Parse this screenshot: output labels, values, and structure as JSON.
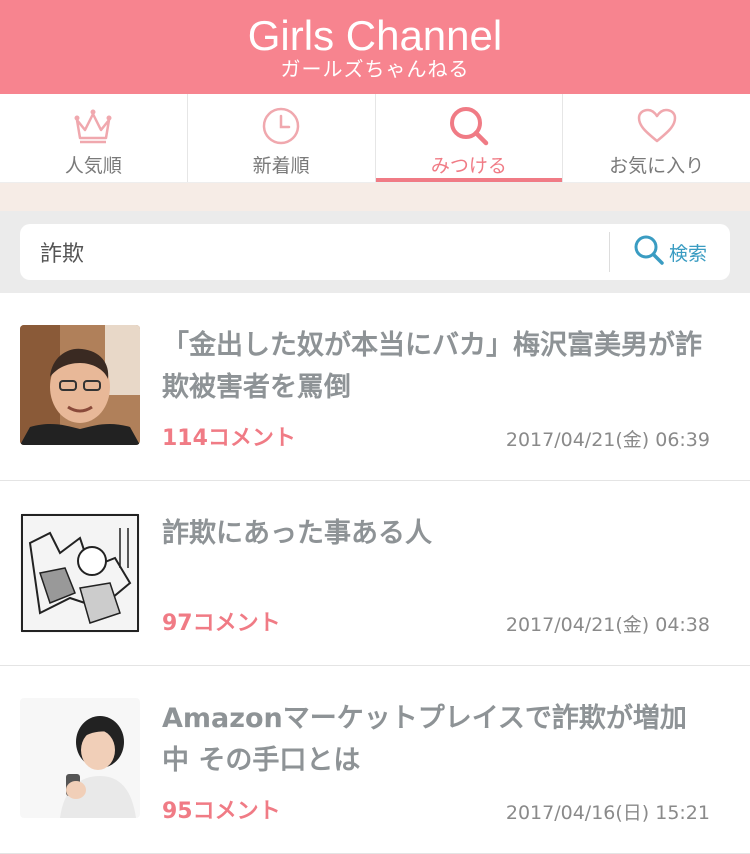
{
  "header": {
    "logo": "Girls Channel",
    "sublogo": "ガールズちゃんねる"
  },
  "tabs": [
    {
      "label": "人気順",
      "icon": "crown-icon"
    },
    {
      "label": "新着順",
      "icon": "clock-icon"
    },
    {
      "label": "みつける",
      "icon": "search-icon",
      "active": true
    },
    {
      "label": "お気に入り",
      "icon": "heart-icon"
    }
  ],
  "search": {
    "value": "詐欺",
    "button_label": "検索"
  },
  "topics": [
    {
      "title": "「金出した奴が本当にバカ」梅沢富美男が詐欺被害者を罵倒",
      "comments": "114コメント",
      "date": "2017/04/21(金) 06:39"
    },
    {
      "title": "詐欺にあった事ある人",
      "comments": "97コメント",
      "date": "2017/04/21(金) 04:38"
    },
    {
      "title": "Amazonマーケットプレイスで詐欺が増加中 その手口とは",
      "comments": "95コメント",
      "date": "2017/04/16(日) 15:21"
    }
  ],
  "colors": {
    "brand": "#f7848f",
    "accent": "#f07b85",
    "link": "#3a9cc2"
  }
}
